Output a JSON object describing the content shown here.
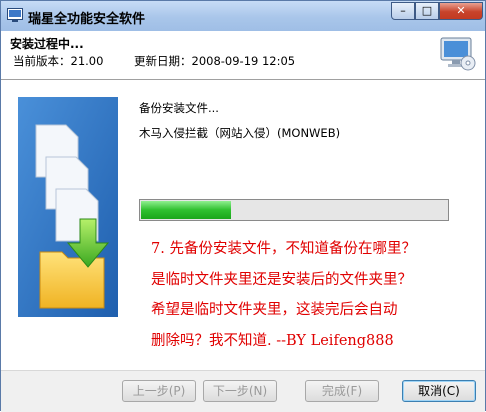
{
  "window": {
    "title": "瑞星全功能安全软件",
    "controls": {
      "minimize": "–",
      "maximize": "□",
      "close": "✕"
    }
  },
  "header": {
    "title": "安装过程中...",
    "version_label": "当前版本：21.00",
    "update_label": "更新日期：2008-09-19 12:05"
  },
  "main": {
    "status_line1": "备份安装文件...",
    "status_line2": "木马入侵拦截（网站入侵）(MONWEB)",
    "progress_fraction": 0.3
  },
  "annotation": {
    "color": "#e00000",
    "lines": [
      "7. 先备份安装文件，不知道备份在哪里？",
      "是临时文件夹里还是安装后的文件夹里？",
      "希望是临时文件夹里，这装完后会自动",
      "删除吗？我不知道. --BY Leifeng888"
    ]
  },
  "footer": {
    "prev_label": "上一步(P)",
    "next_label": "下一步(N)",
    "finish_label": "完成(F)",
    "cancel_label": "取消(C)"
  }
}
